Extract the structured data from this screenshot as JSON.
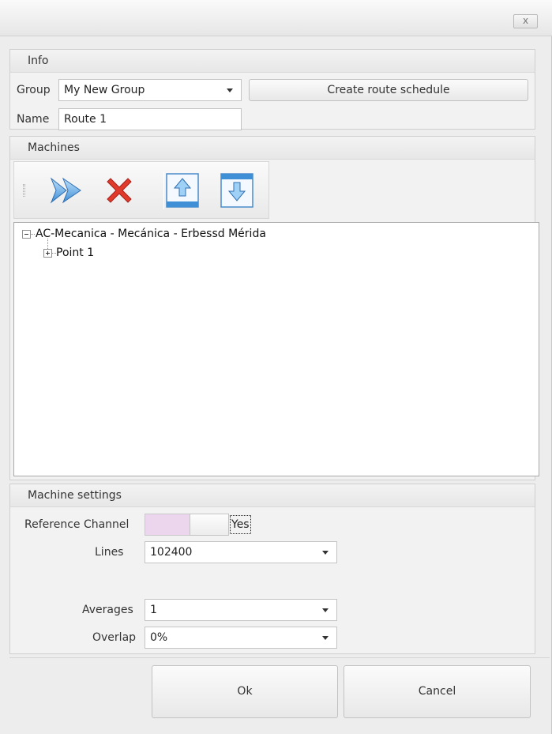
{
  "window": {
    "close_glyph": "x",
    "close_icon": "close-icon"
  },
  "info": {
    "header": "Info",
    "group_label": "Group",
    "group_value": "My New Group",
    "create_schedule_label": "Create route schedule",
    "name_label": "Name",
    "name_value": "Route 1"
  },
  "machines": {
    "header": "Machines",
    "toolbar": {
      "icons": [
        "add-forward-icon",
        "delete-icon",
        "move-up-icon",
        "move-down-icon"
      ]
    },
    "tree": [
      {
        "label": "AC-Mecanica - Mecánica - Erbessd Mérida",
        "expanded": true
      },
      {
        "label": "Point 1",
        "expanded": false
      }
    ]
  },
  "machine_settings": {
    "header": "Machine settings",
    "reference_channel_label": "Reference Channel",
    "reference_channel_value": "Yes",
    "lines_label": "Lines",
    "lines_value": "102400",
    "averages_label": "Averages",
    "averages_value": "1",
    "overlap_label": "Overlap",
    "overlap_value": "0%"
  },
  "footer": {
    "ok_label": "Ok",
    "cancel_label": "Cancel"
  },
  "colors": {
    "arrow_blue": "#3f8fd6",
    "delete_red": "#e03a2a",
    "toggle_pink": "#ecd6ee"
  }
}
